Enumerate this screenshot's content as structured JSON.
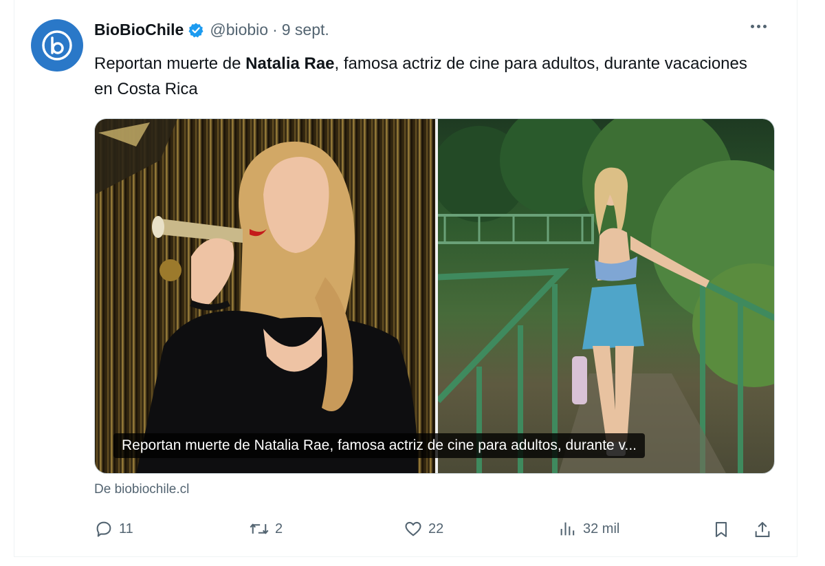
{
  "tweet": {
    "author_name": "BioBioChile",
    "handle": "@biobio",
    "separator": "·",
    "date": "9 sept.",
    "text_before": "Reportan muerte de ",
    "text_bold": "Natalia Rae",
    "text_after": ", famosa actriz de cine para adultos, durante vacaciones en Costa Rica"
  },
  "card": {
    "caption": "Reportan muerte de Natalia Rae, famosa actriz de cine para adultos, durante v...",
    "source": "De biobiochile.cl"
  },
  "actions": {
    "replies": "11",
    "reposts": "2",
    "likes": "22",
    "views": "32 mil"
  },
  "icons": {
    "avatar": "biobio-logo-icon",
    "verified": "verified-badge-icon",
    "more": "more-options-icon",
    "reply": "reply-icon",
    "repost": "repost-icon",
    "like": "heart-icon",
    "views": "views-chart-icon",
    "bookmark": "bookmark-icon",
    "share": "share-icon"
  },
  "colors": {
    "brand_blue": "#2a78c8",
    "verified_blue": "#1d9bf0",
    "text_primary": "#0f1419",
    "text_secondary": "#536471"
  }
}
